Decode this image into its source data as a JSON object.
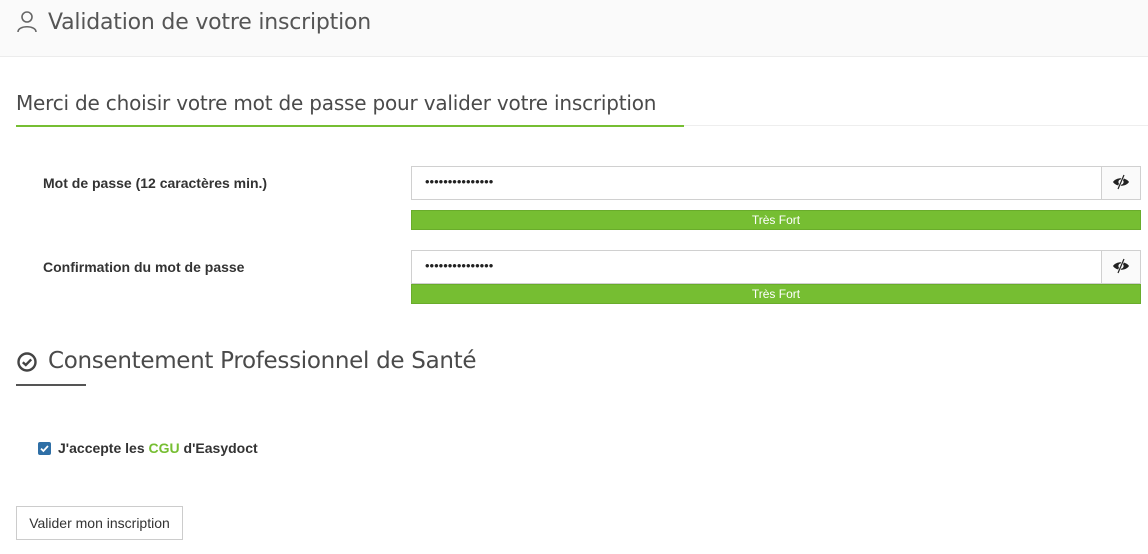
{
  "header": {
    "title": "Validation de votre inscription",
    "icon": "user-icon"
  },
  "password_section": {
    "heading": "Merci de choisir votre mot de passe pour valider votre inscription",
    "password": {
      "label": "Mot de passe (12 caractères min.)",
      "value": "•••••••••••••••",
      "strength": "Très Fort"
    },
    "confirm": {
      "label": "Confirmation du mot de passe",
      "value": "•••••••••••••••",
      "strength": "Très Fort"
    },
    "toggle_icon": "eye-slash-icon"
  },
  "consent_section": {
    "heading": "Consentement Professionnel de Santé",
    "icon": "check-circle-icon",
    "checkbox_checked": true,
    "accept_prefix": "J'accepte les ",
    "accept_link": "CGU",
    "accept_suffix": " d'Easydoct"
  },
  "submit_label": "Valider mon inscription",
  "colors": {
    "accent": "#76be32",
    "checkbox": "#2f6fa6"
  }
}
